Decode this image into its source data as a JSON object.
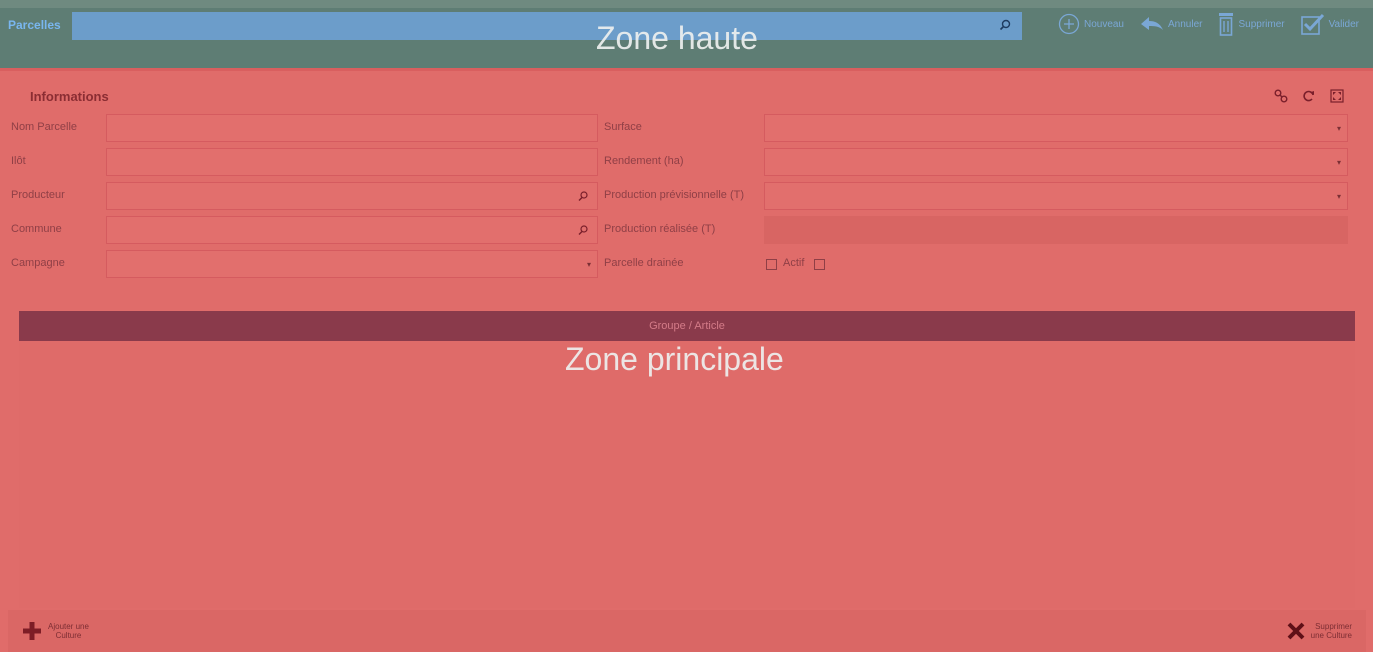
{
  "header": {
    "title": "Parcelles",
    "search_placeholder": "",
    "zone_label": "Zone haute",
    "actions": {
      "new": "Nouveau",
      "cancel": "Annuler",
      "delete": "Supprimer",
      "validate": "Valider"
    }
  },
  "informations": {
    "title": "Informations",
    "left": [
      {
        "label": "Nom Parcelle",
        "value": "",
        "icon": null
      },
      {
        "label": "Ilôt",
        "value": "",
        "icon": null
      },
      {
        "label": "Producteur",
        "value": "",
        "icon": "search-icon"
      },
      {
        "label": "Commune",
        "value": "",
        "icon": "search-icon"
      },
      {
        "label": "Campagne",
        "value": "",
        "icon": "chevron-down-icon"
      }
    ],
    "right": [
      {
        "label": "Surface",
        "value": "",
        "icon": "chevron-down-icon"
      },
      {
        "label": "Rendement (ha)",
        "value": "",
        "icon": "chevron-down-icon"
      },
      {
        "label": "Production prévisionnelle (T)",
        "value": "",
        "icon": "chevron-down-icon"
      },
      {
        "label": "Production réalisée (T)",
        "value": "",
        "icon": null
      },
      {
        "label": "Parcelle drainée",
        "value": "",
        "icon": null
      }
    ],
    "actif_label": "Actif",
    "drainee_checked": false,
    "actif_checked": false
  },
  "grid": {
    "header": "Groupe / Article",
    "zone_label": "Zone principale"
  },
  "bottom": {
    "add_line1": "Ajouter une",
    "add_line2": "Culture",
    "del_line1": "Supprimer",
    "del_line2": "une Culture"
  },
  "colors": {
    "top_zone": "#5e7d74",
    "search": "#6c9dca",
    "main_zone": "#e06c6a",
    "grid_header": "#8a3a4b"
  }
}
